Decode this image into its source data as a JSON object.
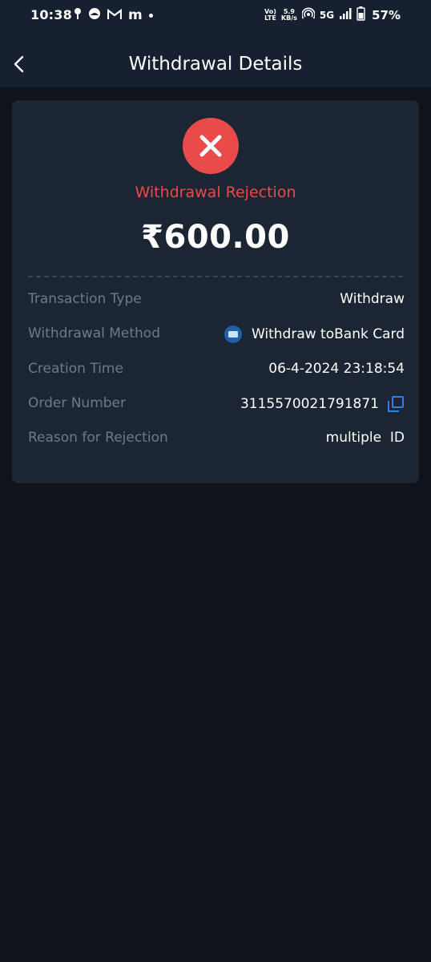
{
  "status_bar": {
    "time": "10:38",
    "network_volte": "Vo) LTE",
    "network_volte_top": "Vo)",
    "network_volte_bottom": "LTE",
    "data_speed_top": "5.9",
    "data_speed_bottom": "KB/s",
    "network_type": "5G",
    "battery": "57%",
    "icons_left": [
      "location-pin-icon",
      "browser-icon",
      "gmail-icon",
      "m-app-icon",
      "notification-dot-icon"
    ],
    "icons_right": [
      "volte-icon",
      "data-speed-icon",
      "hotspot-icon",
      "5g-icon",
      "signal-icon",
      "battery-icon"
    ],
    "m_label": "m"
  },
  "header": {
    "title": "Withdrawal Details",
    "back_icon": "chevron-left-icon"
  },
  "withdrawal": {
    "status_icon": "close-icon",
    "status": "Withdrawal Rejection",
    "amount": "₹600.00",
    "details": {
      "transaction_type_label": "Transaction Type",
      "transaction_type_value": "Withdraw",
      "method_label": "Withdrawal Method",
      "method_value": "Withdraw toBank Card",
      "method_icon": "bank-logo-icon",
      "creation_time_label": "Creation Time",
      "creation_time_value": "06-4-2024 23:18:54",
      "order_number_label": "Order Number",
      "order_number_value": "3115570021791871",
      "order_copy_icon": "copy-icon",
      "reason_label": "Reason for Rejection",
      "reason_value": "multiple  ID"
    }
  },
  "colors": {
    "background": "#0f141c",
    "header": "#162030",
    "card": "#1c2533",
    "error": "#e94a4a",
    "label": "#6b7a8e",
    "accent": "#2f7fe6"
  }
}
